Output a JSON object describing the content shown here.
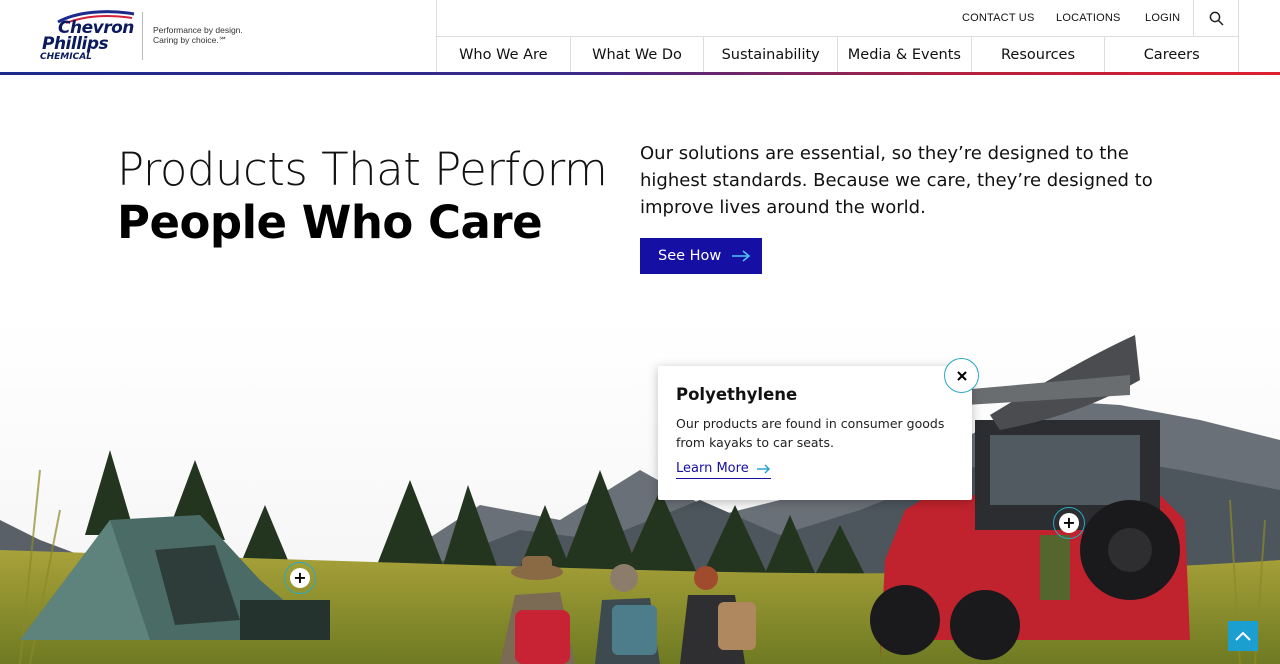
{
  "brand": {
    "logo_line1": "Chevron",
    "logo_line2": "Phillips",
    "logo_line3": "CHEMICAL",
    "tagline_1": "Performance by design.",
    "tagline_2": "Caring by choice.℠"
  },
  "utility_nav": {
    "contact": "CONTACT US",
    "locations": "LOCATIONS",
    "login": "LOGIN",
    "search_icon": "search-icon"
  },
  "main_nav": [
    {
      "label": "Who We Are"
    },
    {
      "label": "What We Do"
    },
    {
      "label": "Sustainability"
    },
    {
      "label": "Media & Events"
    },
    {
      "label": "Resources"
    },
    {
      "label": "Careers"
    }
  ],
  "hero": {
    "line1": "Products That Perform",
    "line2": "People Who Care",
    "description": "Our solutions are essential, so they’re designed to the highest standards. Because we care, they’re designed to improve lives around the world.",
    "cta_label": "See How"
  },
  "popup": {
    "title": "Polyethylene",
    "body": "Our products are found in consumer goods from kayaks to car seats.",
    "link_label": "Learn More",
    "close_icon": "close-icon"
  },
  "hotspots": [
    {
      "icon": "plus-icon",
      "label": "+"
    },
    {
      "icon": "plus-icon",
      "label": "+"
    }
  ],
  "colors": {
    "brand_navy": "#0b1a5c",
    "cta_blue": "#1510a3",
    "hotspot_ring": "#2aa8c4",
    "back_to_top": "#1b9fd0",
    "accent_red": "#e0202f"
  }
}
